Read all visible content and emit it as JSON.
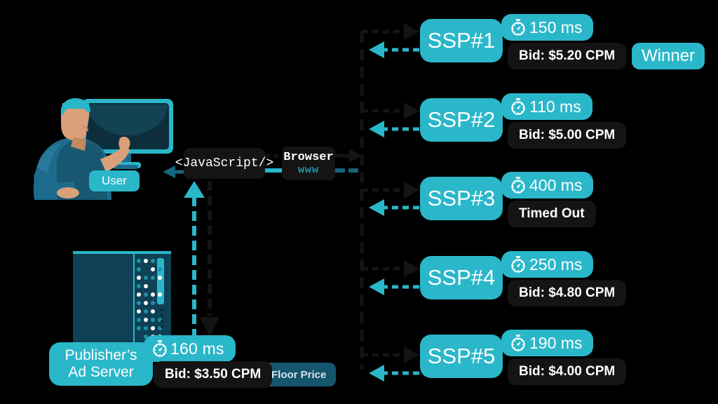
{
  "colors": {
    "teal": "#2ab7c9",
    "dark": "#141414",
    "dark_teal": "#15566e",
    "background": "#000000",
    "skin": "#d9a07a",
    "sweater": "#1d6b8c"
  },
  "diagram": {
    "title": "Header bidding auction flow",
    "user": {
      "label": "User",
      "icon": "person-at-computer-illustration"
    },
    "javascript_node": {
      "label": "<JavaScript/>"
    },
    "browser_node": {
      "label": "Browser",
      "sublabel": "www"
    },
    "ad_server": {
      "name_line_1": "Publisher’s",
      "name_line_2": "Ad Server",
      "time": "160 ms",
      "bid": "Bid: $3.50 CPM",
      "floor_price": "Floor Price",
      "icon": "server-rack-illustration",
      "timer_icon": "stopwatch-icon"
    },
    "ssps": [
      {
        "name": "SSP#1",
        "time": "150 ms",
        "bid": "Bid: $5.20 CPM",
        "badge": "Winner",
        "timer_icon": "stopwatch-icon"
      },
      {
        "name": "SSP#2",
        "time": "110 ms",
        "bid": "Bid: $5.00 CPM",
        "badge": "",
        "timer_icon": "stopwatch-icon"
      },
      {
        "name": "SSP#3",
        "time": "400 ms",
        "bid": "Timed Out",
        "badge": "",
        "timer_icon": "stopwatch-icon"
      },
      {
        "name": "SSP#4",
        "time": "250 ms",
        "bid": "Bid: $4.80 CPM",
        "badge": "",
        "timer_icon": "stopwatch-icon"
      },
      {
        "name": "SSP#5",
        "time": "190 ms",
        "bid": "Bid: $4.00 CPM",
        "badge": "",
        "timer_icon": "stopwatch-icon"
      }
    ]
  }
}
